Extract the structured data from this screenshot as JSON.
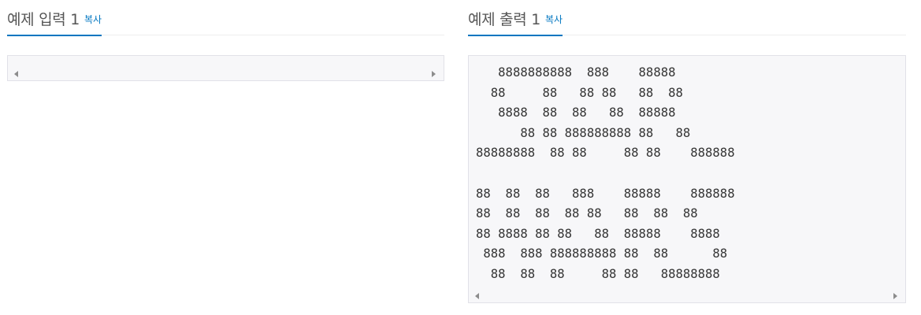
{
  "input_panel": {
    "title": "예제 입력 1",
    "copy_label": "복사",
    "content": ""
  },
  "output_panel": {
    "title": "예제 출력 1",
    "copy_label": "복사",
    "content": "   8888888888  888    88888\n  88     88   88 88   88  88\n   8888  88  88   88  88888\n      88 88 888888888 88   88\n88888888  88 88     88 88    888888\n\n88  88  88   888    88888    888888\n88  88  88  88 88   88  88  88\n88 8888 88 88   88  88888    8888\n 888  888 888888888 88  88      88\n  88  88  88     88 88   88888888"
  },
  "colors": {
    "accent": "#0076c0",
    "title_text": "#555555",
    "code_bg": "#f7f7f9",
    "code_border": "#e1e1e8"
  }
}
